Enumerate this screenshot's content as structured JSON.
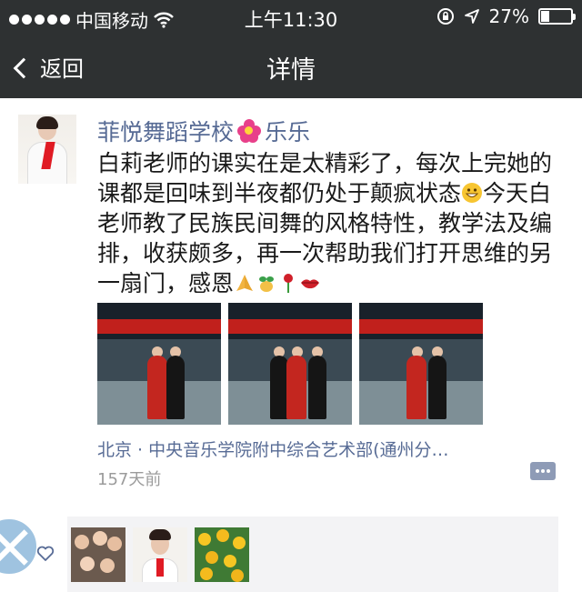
{
  "status_bar": {
    "carrier": "中国移动",
    "time": "上午11:30",
    "battery": "27%",
    "battery_level": 0.27,
    "icons": [
      "signal-dots-icon",
      "wifi-icon",
      "rotation-lock-icon",
      "location-arrow-icon",
      "battery-icon"
    ]
  },
  "nav": {
    "back_label": "返回",
    "title": "详情"
  },
  "post": {
    "author_name": "菲悦舞蹈学校",
    "author_suffix": "乐乐",
    "text_part1": "白莉老师的课实在是太精彩了，每次上完她的课都是回味到半夜都仍处于颠疯状态",
    "text_part2": "今天白老师教了民族民间舞的风格特性，教学法及编排，收获颇多，再一次帮助我们打开思维的另一扇门，感恩",
    "photos": [
      "dance-class-photo-1",
      "dance-class-photo-2",
      "dance-class-photo-3"
    ],
    "location": "北京 · 中央音乐学院附中综合艺术部(通州分…",
    "time_ago": "157天前"
  },
  "likes": {
    "avatars": [
      "group-kids-avatar",
      "woman-red-scarf-avatar",
      "sunflowers-avatar"
    ]
  },
  "colors": {
    "bar_bg": "#2e3132",
    "link_blue": "#576b95",
    "likes_bg": "#f3f3f5"
  }
}
